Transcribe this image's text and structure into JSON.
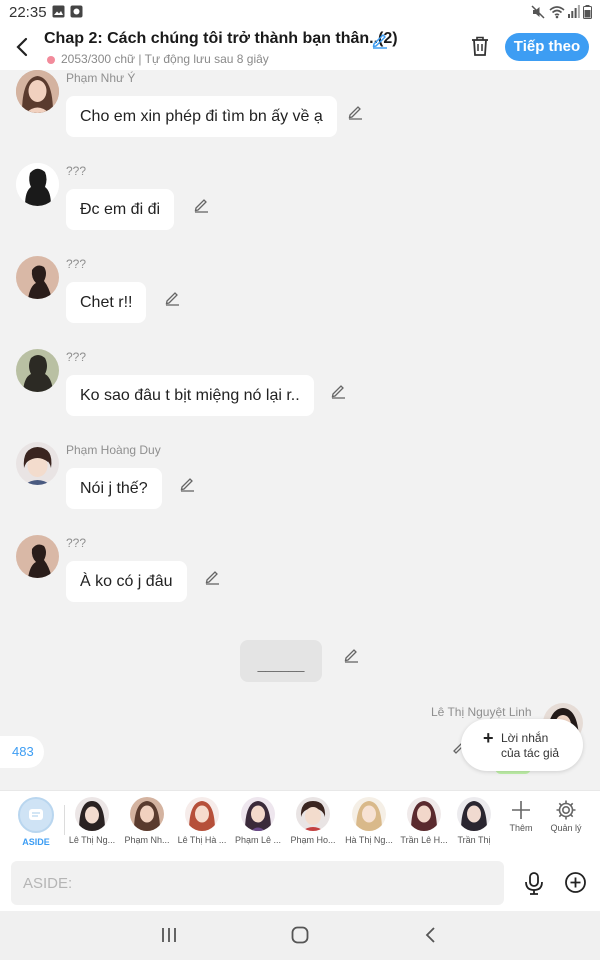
{
  "status_bar": {
    "time": "22:35",
    "icons": [
      "image-icon",
      "app-notification-icon",
      "mute-icon",
      "wifi-icon",
      "signal-icon",
      "battery-icon"
    ]
  },
  "header": {
    "title": "Chap 2: Cách chúng tôi trở thành bạn thân..(2)",
    "subtitle": "2053/300 chữ | Tự động lưu sau 8 giây",
    "next_button": "Tiếp theo"
  },
  "messages": [
    {
      "sender": "Phạm Như Ý",
      "text": "Cho em xin phép đi tìm bn ấy về ạ"
    },
    {
      "sender": "???",
      "text": "Đc em đi đi"
    },
    {
      "sender": "???",
      "text": "Chet r!!"
    },
    {
      "sender": "???",
      "text": "Ko sao đâu t bịt miệng nó lại r.."
    },
    {
      "sender": "Phạm Hoàng Duy",
      "text": "Nói j thế?"
    },
    {
      "sender": "???",
      "text": "À ko có j đâu"
    }
  ],
  "divider_text": "______",
  "right_message": {
    "sender": "Lê Thị Nguyệt Linh"
  },
  "count_badge": "483",
  "author_note": {
    "line1": "Lời nhắn",
    "line2": "của tác giả"
  },
  "characters": [
    {
      "name": "ASIDE"
    },
    {
      "name": "Lê Thị Ng..."
    },
    {
      "name": "Phạm Nh..."
    },
    {
      "name": "Lê Thị Hà ..."
    },
    {
      "name": "Phạm Lê ..."
    },
    {
      "name": "Phạm Ho..."
    },
    {
      "name": "Hà Thị Ng..."
    },
    {
      "name": "Trần Lê H..."
    },
    {
      "name": "Trần Thị"
    }
  ],
  "tools": {
    "add_label": "Thêm",
    "manage_label": "Quản lý"
  },
  "input": {
    "placeholder": "ASIDE:"
  },
  "colors": {
    "accent": "#3d9df3",
    "background": "#f2f2f2",
    "bubble": "#ffffff"
  }
}
